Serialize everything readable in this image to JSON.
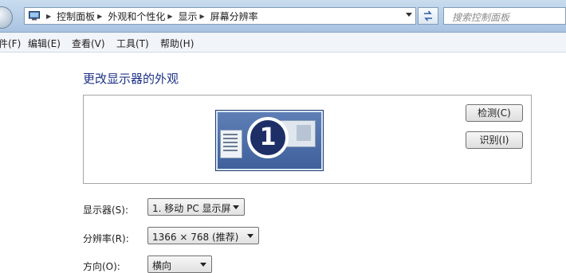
{
  "breadcrumb": [
    "控制面板",
    "外观和个性化",
    "显示",
    "屏幕分辨率"
  ],
  "search": {
    "placeholder": "搜索控制面板"
  },
  "menu": [
    {
      "label": "件(F)"
    },
    {
      "label": "编辑(E)"
    },
    {
      "label": "查看(V)"
    },
    {
      "label": "工具(T)"
    },
    {
      "label": "帮助(H)"
    }
  ],
  "page": {
    "heading": "更改显示器的外观"
  },
  "preview": {
    "monitor_number": "1"
  },
  "buttons": {
    "detect": "检测(C)",
    "identify": "识别(I)"
  },
  "settings": {
    "display_label": "显示器(S):",
    "display_value": "1. 移动 PC 显示屏",
    "resolution_label": "分辨率(R):",
    "resolution_value": "1366 × 768 (推荐)",
    "orientation_label": "方向(O):",
    "orientation_value": "横向"
  },
  "colors": {
    "heading": "#1e3287",
    "monitor": "#3e5f9b"
  }
}
